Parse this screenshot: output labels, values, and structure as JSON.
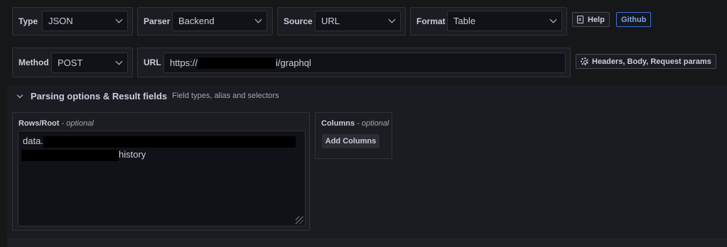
{
  "row1": {
    "type": {
      "label": "Type",
      "value": "JSON"
    },
    "parser": {
      "label": "Parser",
      "value": "Backend"
    },
    "source": {
      "label": "Source",
      "value": "URL"
    },
    "format": {
      "label": "Format",
      "value": "Table"
    },
    "help_button": "Help",
    "github_link": "Github"
  },
  "row2": {
    "method": {
      "label": "Method",
      "value": "POST"
    },
    "url": {
      "label": "URL",
      "prefix": "https://",
      "suffix": "i/graphql"
    },
    "headers_button": "Headers, Body, Request params"
  },
  "parsing": {
    "title": "Parsing options & Result fields",
    "description": "Field types, alias and selectors",
    "rows_root": {
      "label": "Rows/Root",
      "optional": "- optional",
      "line1_prefix": "data.",
      "line2_suffix": "history"
    },
    "columns": {
      "label": "Columns",
      "optional": "- optional",
      "add_button": "Add Columns"
    }
  },
  "icons": {
    "chevron": "chevron-down-icon",
    "help": "document-icon",
    "settings": "gear-icon",
    "collapse": "chevron-down-icon",
    "resize": "resize-grip-icon"
  }
}
